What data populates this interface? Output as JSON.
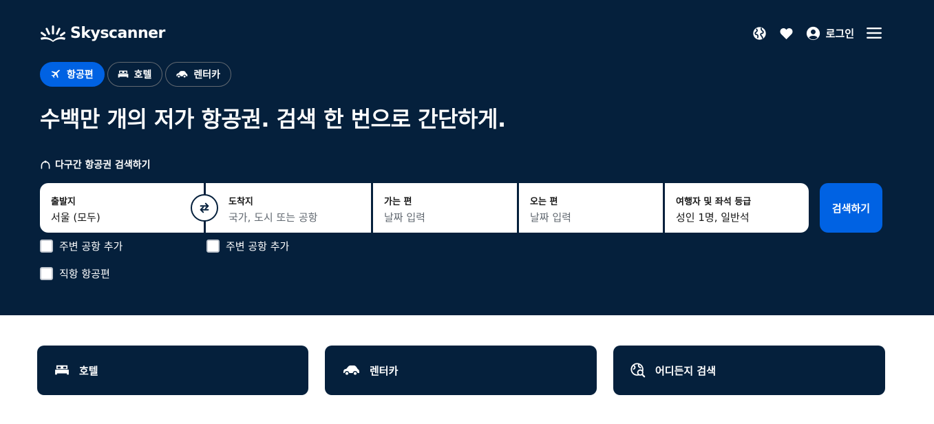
{
  "header": {
    "logo_text": "Skyscanner",
    "login_label": "로그인",
    "icons": [
      "globe-icon",
      "heart-icon",
      "account-icon",
      "hamburger-menu-icon"
    ]
  },
  "tabs": [
    {
      "label": "항공편",
      "icon": "plane-icon",
      "active": true
    },
    {
      "label": "호텔",
      "icon": "bed-icon",
      "active": false
    },
    {
      "label": "렌터카",
      "icon": "car-icon",
      "active": false
    }
  ],
  "headline": "수백만 개의 저가 항공권. 검색 한 번으로 간단하게.",
  "multi_city_link": "다구간 항공권 검색하기",
  "search": {
    "origin": {
      "label": "출발지",
      "value": "서울 (모두)"
    },
    "destination": {
      "label": "도착지",
      "placeholder": "국가, 도시 또는 공항"
    },
    "depart": {
      "label": "가는 편",
      "placeholder": "날짜 입력"
    },
    "return": {
      "label": "오는 편",
      "placeholder": "날짜 입력"
    },
    "travellers": {
      "label": "여행자 및 좌석 등급",
      "value": "성인 1명, 일반석"
    },
    "submit_label": "검색하기"
  },
  "checkboxes": {
    "origin_nearby": {
      "label": "주변 공항 추가",
      "checked": false
    },
    "dest_nearby": {
      "label": "주변 공항 추가",
      "checked": false
    },
    "direct_only": {
      "label": "직항 항공편",
      "checked": false
    }
  },
  "cards": [
    {
      "label": "호텔",
      "icon": "bed-icon"
    },
    {
      "label": "렌터카",
      "icon": "car-icon"
    },
    {
      "label": "어디든지 검색",
      "icon": "globe-search-icon"
    }
  ],
  "colors": {
    "hero_bg": "#05203c",
    "accent_blue": "#0062e3",
    "text_white": "#ffffff",
    "placeholder": "#626971"
  }
}
